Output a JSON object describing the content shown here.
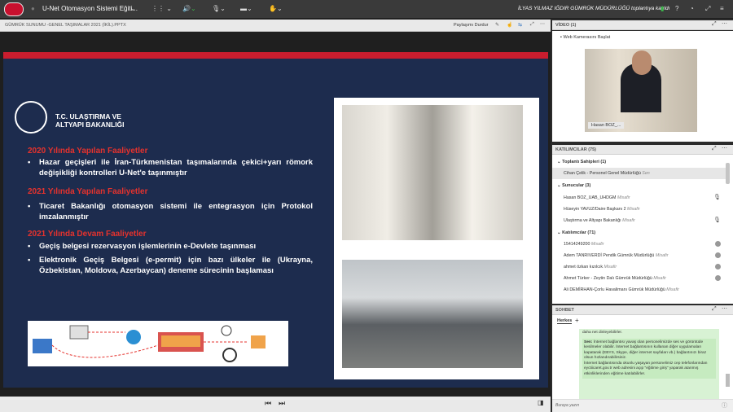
{
  "topbar": {
    "app_title": "U-Net Otomasyon Sistemi Eğiti...",
    "host": "İLYAS YILMAZ IĞDIR GÜMRÜK MÜDÜRLÜĞÜ toplantıya katıldı"
  },
  "share": {
    "title": "GÜMRÜK SUNUMU -GENEL TAŞIMALAR 2021 (İKİL).PPTX",
    "stop_label": "Paylaşımı Durdur"
  },
  "slide": {
    "ministry": "T.C. ULAŞTIRMA VE\nALTYAPI BAKANLIĞI",
    "sections": [
      {
        "heading": "2020 Yılında Yapılan Faaliyetler",
        "bullets": [
          "Hazar geçişleri ile İran-Türkmenistan taşımalarında çekici+yarı römork değişikliği kontrolleri U-Net'e taşınmıştır"
        ]
      },
      {
        "heading": "2021 Yılında Yapılan Faaliyetler",
        "bullets": [
          "Ticaret Bakanlığı otomasyon sistemi ile entegrasyon için Protokol imzalanmıştır"
        ]
      },
      {
        "heading": "2021 Yılında Devam Faaliyetler",
        "bullets": [
          "Geçiş belgesi rezervasyon işlemlerinin e-Devlete taşınması",
          "Elektronik Geçiş Belgesi (e-permit) için bazı ülkeler ile (Ukrayna, Özbekistan, Moldova, Azerbaycan) deneme sürecinin başlaması"
        ]
      }
    ]
  },
  "video": {
    "title": "VİDEO (1)",
    "cam_label": "Web Kamerasını Başlat",
    "tag": "Hasan BOZ_..."
  },
  "participants": {
    "title": "KATILIMCILAR (75)",
    "hosts_label": "Toplantı Sahipleri (1)",
    "hosts": [
      {
        "name": "Cihan Çelik - Personel Genel Müdürlüğü",
        "role": "Sen"
      }
    ],
    "presenters_label": "Sunucular (3)",
    "presenters": [
      {
        "name": "Hasan BOZ_UAB_UHDGM",
        "role": "Misafir"
      },
      {
        "name": "Hüseyin YAVUZ/Daire Başkanı 2",
        "role": "Misafir"
      },
      {
        "name": "Ulaştırma ve Altyapı Bakanlığı",
        "role": "Misafir"
      }
    ],
    "attendees_label": "Katılımcılar (71)",
    "attendees": [
      {
        "name": "15414249200",
        "role": "Misafir"
      },
      {
        "name": "Adem TANRIVERDİ Pendik Gümrük Müdürlüğü",
        "role": "Misafir"
      },
      {
        "name": "ahmet özkan kızılcık",
        "role": "Misafir"
      },
      {
        "name": "Ahmet Türker - Zeytin Dalı Gümrük Müdürlüğü",
        "role": "Misafir"
      },
      {
        "name": "Ali DEMİRHAN-Çorlu Havalimanı Gümrük Müdürlüğü",
        "role": "Misafir"
      }
    ]
  },
  "chat": {
    "title": "SOHBET",
    "tab": "Herkes",
    "prev_text": "daha net dinleyebilirler.",
    "sender": "Sen:",
    "message": "İnternet bağlantısı yavaş olan personelimizde ses ve görüntüde kesilmeler olabilir. İnternet bağlantısının kullanan diğer uygulamaları kapatarak (EBYS, Skype, diğer internet sayfaları vb.) bağlantınızı biraz olsun hızlandırabilirsiniz.\nİnternet bağlantısında okunlu yaşayan personelimiz cep telefonlarından eyctiicaret.gov.tr web adresini açıp \"eğitime giriş\" yaparak atanmış etkinliklerinden eğitime katılabilirler.",
    "input_placeholder": "Buraya yazın"
  }
}
